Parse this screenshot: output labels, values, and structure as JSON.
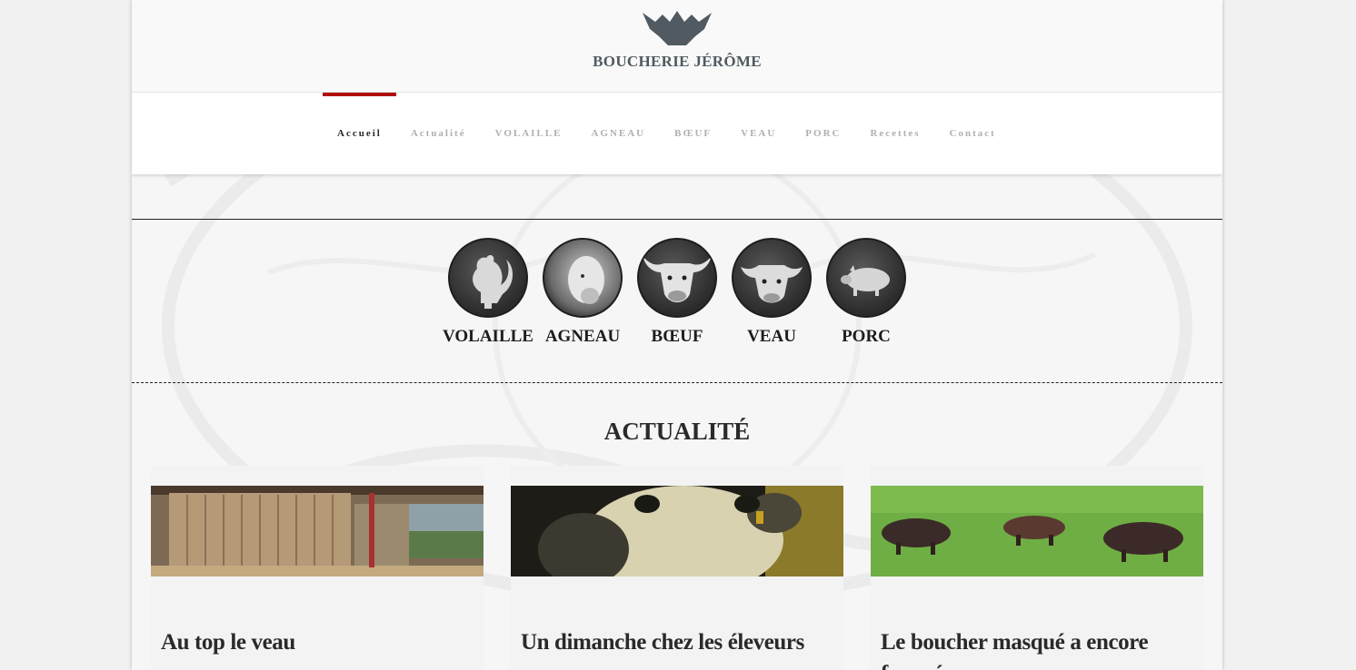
{
  "site": {
    "logo_text": "BOUCHERIE JÉRÔME"
  },
  "nav": {
    "items": [
      {
        "label": "Accueil",
        "active": true
      },
      {
        "label": "Actualité",
        "active": false
      },
      {
        "label": "VOLAILLE",
        "active": false
      },
      {
        "label": "AGNEAU",
        "active": false
      },
      {
        "label": "BŒUF",
        "active": false
      },
      {
        "label": "VEAU",
        "active": false
      },
      {
        "label": "PORC",
        "active": false
      },
      {
        "label": "Recettes",
        "active": false
      },
      {
        "label": "Contact",
        "active": false
      }
    ]
  },
  "categories": [
    {
      "label": "VOLAILLE",
      "icon": "rooster-icon"
    },
    {
      "label": "AGNEAU",
      "icon": "sheep-icon"
    },
    {
      "label": "BŒUF",
      "icon": "bull-icon"
    },
    {
      "label": "VEAU",
      "icon": "calf-icon"
    },
    {
      "label": "PORC",
      "icon": "pig-icon"
    }
  ],
  "news": {
    "heading": "ACTUALITÉ",
    "cards": [
      {
        "title": "Au top le veau",
        "image": "barn-photo"
      },
      {
        "title": "Un dimanche chez les éleveurs",
        "image": "cow-closeup-photo"
      },
      {
        "title": "Le boucher masqué a encore frappé",
        "image": "pigs-in-field-photo"
      }
    ]
  },
  "colors": {
    "accent": "#b00f0f",
    "text_dark": "#2a2a2a",
    "nav_inactive": "#b0b0b0",
    "logo": "#505a60"
  }
}
